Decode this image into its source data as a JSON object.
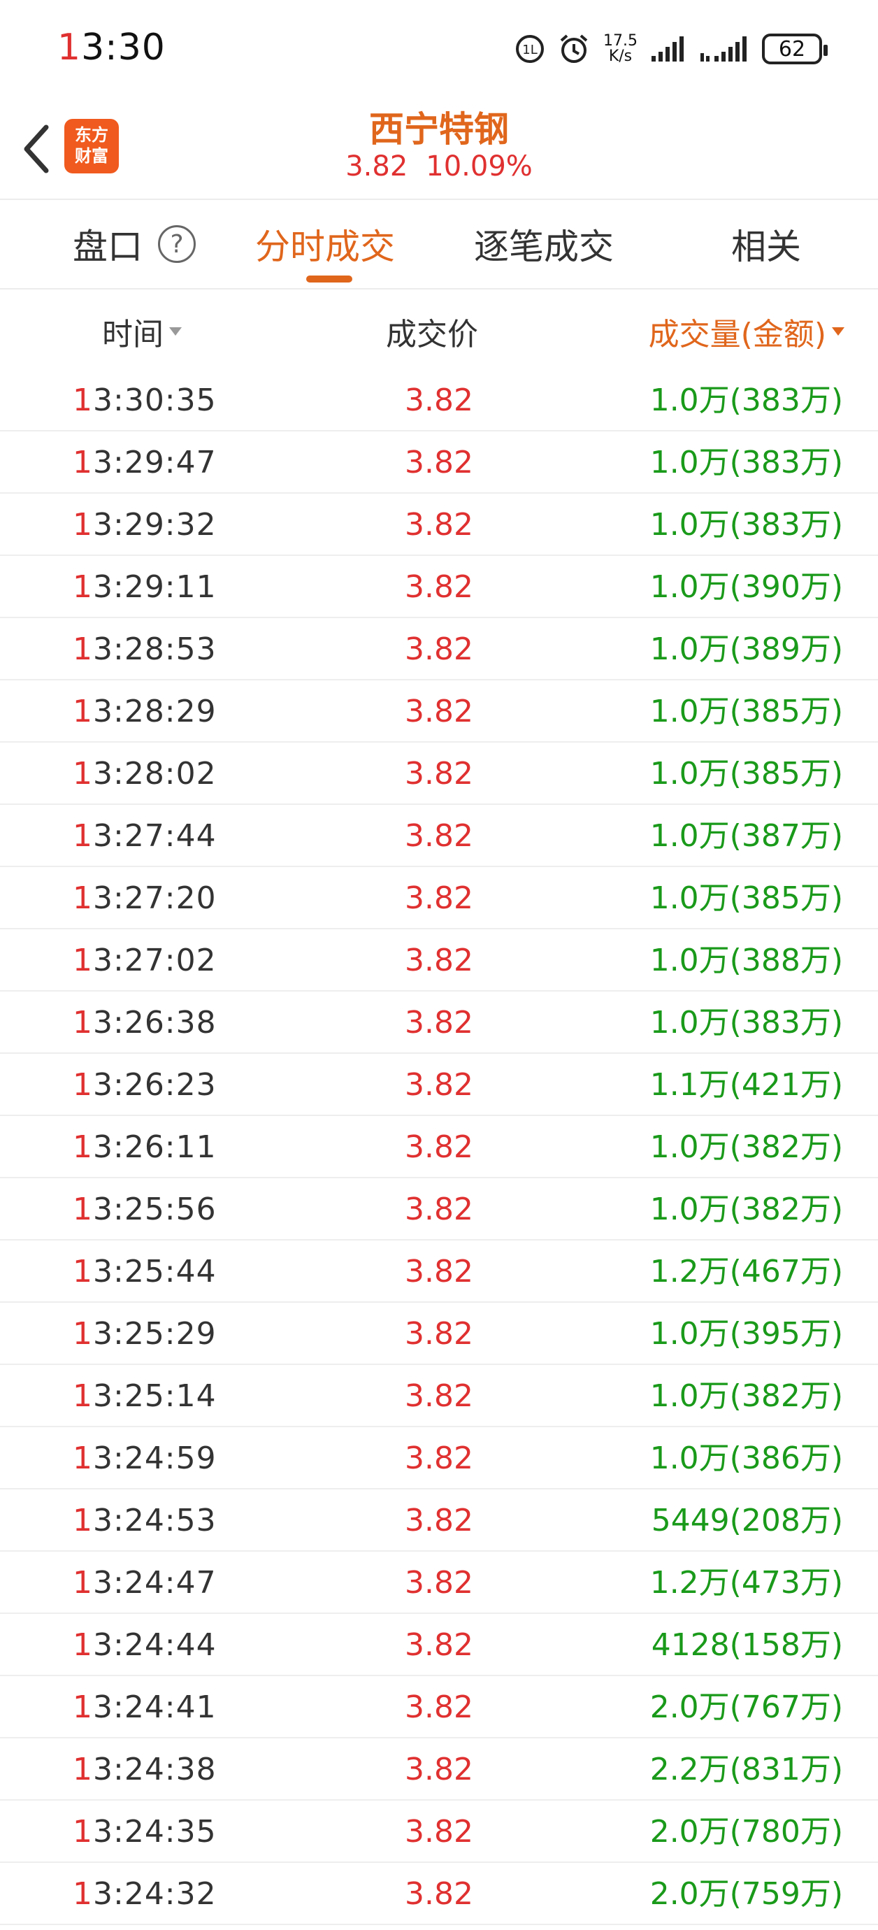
{
  "status_bar": {
    "time_first": "1",
    "time_rest": "3:30",
    "net_speed_value": "17.5",
    "net_speed_unit": "K/s",
    "battery": "62"
  },
  "header": {
    "logo_line1": "东方",
    "logo_line2": "财富",
    "stock_name": "西宁特钢",
    "price": "3.82",
    "change_pct": "10.09%"
  },
  "tabs": [
    {
      "label": "盘口"
    },
    {
      "label": "分时成交"
    },
    {
      "label": "逐笔成交"
    },
    {
      "label": "相关"
    }
  ],
  "columns": {
    "time": "时间",
    "price": "成交价",
    "amount": "成交量(金额)"
  },
  "colors": {
    "accent_orange": "#e0661c",
    "up_red": "#e03030",
    "volume_green": "#1a9a1a"
  },
  "rows": [
    {
      "time_h": "1",
      "time_rest": "3:30:35",
      "price": "3.82",
      "volume": "1.0万(383万)"
    },
    {
      "time_h": "1",
      "time_rest": "3:29:47",
      "price": "3.82",
      "volume": "1.0万(383万)"
    },
    {
      "time_h": "1",
      "time_rest": "3:29:32",
      "price": "3.82",
      "volume": "1.0万(383万)"
    },
    {
      "time_h": "1",
      "time_rest": "3:29:11",
      "price": "3.82",
      "volume": "1.0万(390万)"
    },
    {
      "time_h": "1",
      "time_rest": "3:28:53",
      "price": "3.82",
      "volume": "1.0万(389万)"
    },
    {
      "time_h": "1",
      "time_rest": "3:28:29",
      "price": "3.82",
      "volume": "1.0万(385万)"
    },
    {
      "time_h": "1",
      "time_rest": "3:28:02",
      "price": "3.82",
      "volume": "1.0万(385万)"
    },
    {
      "time_h": "1",
      "time_rest": "3:27:44",
      "price": "3.82",
      "volume": "1.0万(387万)"
    },
    {
      "time_h": "1",
      "time_rest": "3:27:20",
      "price": "3.82",
      "volume": "1.0万(385万)"
    },
    {
      "time_h": "1",
      "time_rest": "3:27:02",
      "price": "3.82",
      "volume": "1.0万(388万)"
    },
    {
      "time_h": "1",
      "time_rest": "3:26:38",
      "price": "3.82",
      "volume": "1.0万(383万)"
    },
    {
      "time_h": "1",
      "time_rest": "3:26:23",
      "price": "3.82",
      "volume": "1.1万(421万)"
    },
    {
      "time_h": "1",
      "time_rest": "3:26:11",
      "price": "3.82",
      "volume": "1.0万(382万)"
    },
    {
      "time_h": "1",
      "time_rest": "3:25:56",
      "price": "3.82",
      "volume": "1.0万(382万)"
    },
    {
      "time_h": "1",
      "time_rest": "3:25:44",
      "price": "3.82",
      "volume": "1.2万(467万)"
    },
    {
      "time_h": "1",
      "time_rest": "3:25:29",
      "price": "3.82",
      "volume": "1.0万(395万)"
    },
    {
      "time_h": "1",
      "time_rest": "3:25:14",
      "price": "3.82",
      "volume": "1.0万(382万)"
    },
    {
      "time_h": "1",
      "time_rest": "3:24:59",
      "price": "3.82",
      "volume": "1.0万(386万)"
    },
    {
      "time_h": "1",
      "time_rest": "3:24:53",
      "price": "3.82",
      "volume": "5449(208万)"
    },
    {
      "time_h": "1",
      "time_rest": "3:24:47",
      "price": "3.82",
      "volume": "1.2万(473万)"
    },
    {
      "time_h": "1",
      "time_rest": "3:24:44",
      "price": "3.82",
      "volume": "4128(158万)"
    },
    {
      "time_h": "1",
      "time_rest": "3:24:41",
      "price": "3.82",
      "volume": "2.0万(767万)"
    },
    {
      "time_h": "1",
      "time_rest": "3:24:38",
      "price": "3.82",
      "volume": "2.2万(831万)"
    },
    {
      "time_h": "1",
      "time_rest": "3:24:35",
      "price": "3.82",
      "volume": "2.0万(780万)"
    },
    {
      "time_h": "1",
      "time_rest": "3:24:32",
      "price": "3.82",
      "volume": "2.0万(759万)"
    }
  ]
}
